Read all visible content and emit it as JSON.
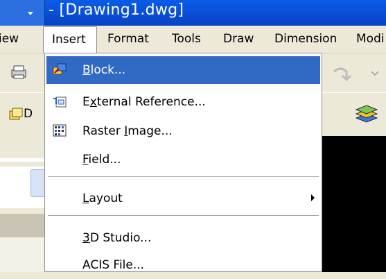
{
  "titlebar": {
    "title": "- [Drawing1.dwg]"
  },
  "menubar": {
    "items": [
      "View",
      "Insert",
      "Format",
      "Tools",
      "Draw",
      "Dimension",
      "Modi"
    ],
    "visible_text": [
      "iew",
      "Insert",
      "Format",
      "Tools",
      "Draw",
      "Dimension",
      "Modi"
    ],
    "active": "Insert"
  },
  "toolbar2": {
    "combo_text": "D"
  },
  "insert_menu": {
    "items": [
      {
        "label": "Block...",
        "accel": "B",
        "icon": "block-icon",
        "highlighted": true
      },
      {
        "label": "External Reference...",
        "accel": "x",
        "icon": "external-reference-icon",
        "highlighted": false
      },
      {
        "label": "Raster Image...",
        "accel": "I",
        "icon": "raster-image-icon",
        "highlighted": false
      },
      {
        "label": "Field...",
        "accel": "F",
        "icon": "",
        "highlighted": false
      },
      {
        "label": "Layout",
        "accel": "L",
        "icon": "",
        "submenu": true
      },
      {
        "label": "3D Studio...",
        "accel": "3",
        "icon": ""
      },
      {
        "label": "ACIS File...",
        "accel": "",
        "icon": ""
      }
    ]
  },
  "colors": {
    "highlight": "#316ac5",
    "titlebar": "#0a4fd6",
    "menu_bg": "#ffffff"
  }
}
